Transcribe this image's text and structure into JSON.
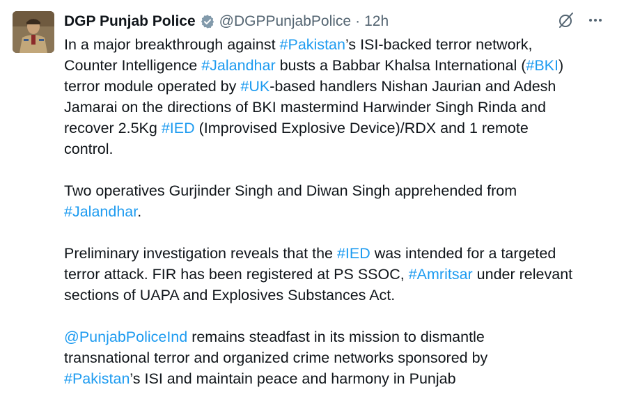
{
  "author": {
    "name": "DGP Punjab Police",
    "handle": "@DGPPunjabPolice",
    "separator": "·",
    "time": "12h"
  },
  "icons": {
    "verified": "verified-badge-icon",
    "grok": "slashed-circle-icon",
    "more": "more-options-icon"
  },
  "colors": {
    "link": "#1d9bf0",
    "text": "#0f1419",
    "secondary": "#536471"
  },
  "tweet": {
    "p1": [
      "In a major breakthrough against ",
      "#Pakistan",
      "’s ISI-backed terror network,",
      "Counter Intelligence ",
      "#Jalandhar",
      " busts a Babbar Khalsa International (",
      "#BKI",
      ")",
      "terror module operated by ",
      "#UK",
      "-based handlers Nishan Jaurian and Adesh",
      "Jamarai on the directions of BKI mastermind Harwinder Singh Rinda and",
      "recover 2.5Kg ",
      "#IED",
      " (Improvised Explosive Device)/RDX and 1 remote",
      "control."
    ],
    "p2": [
      "Two operatives Gurjinder Singh and Diwan Singh apprehended from",
      "#Jalandhar",
      "."
    ],
    "p3": [
      "Preliminary investigation reveals that the ",
      "#IED",
      " was intended for a targeted",
      "terror attack. FIR has been registered at PS SSOC, ",
      "#Amritsar",
      " under relevant",
      "sections of UAPA and Explosives Substances Act."
    ],
    "p4": [
      "@PunjabPoliceInd",
      " remains steadfast in its mission to dismantle",
      "transnational terror and organized crime networks sponsored by",
      "#Pakistan",
      "’s ISI and maintain peace and harmony in Punjab"
    ]
  }
}
